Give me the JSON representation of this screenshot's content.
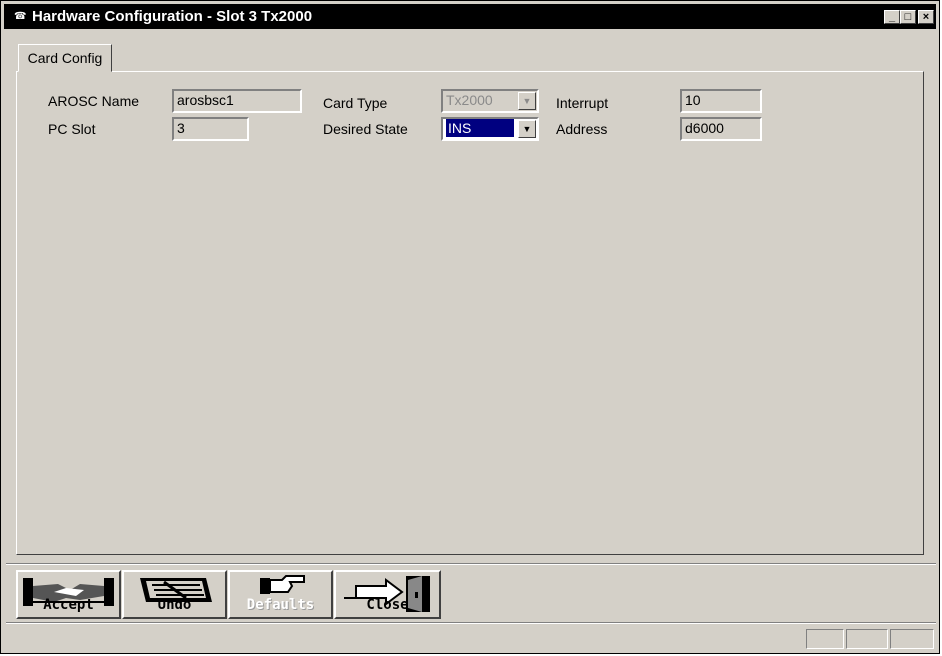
{
  "window": {
    "title": "Hardware Configuration - Slot 3 Tx2000",
    "icon": "telephone-icon",
    "controls": [
      "minimize-icon",
      "maximize-icon",
      "close-icon"
    ]
  },
  "tabs": [
    {
      "label": "Card Config",
      "active": true
    }
  ],
  "form": {
    "arosc_name": {
      "label": "AROSC Name",
      "value": "arosbsc1"
    },
    "pc_slot": {
      "label": "PC Slot",
      "value": "3"
    },
    "card_type": {
      "label": "Card Type",
      "value": "Tx2000",
      "disabled": true
    },
    "desired_state": {
      "label": "Desired State",
      "value": "INS"
    },
    "interrupt": {
      "label": "Interrupt",
      "value": "10"
    },
    "address": {
      "label": "Address",
      "value": "d6000"
    }
  },
  "toolbar": {
    "accept": {
      "label": "Accept",
      "icon": "handshake-icon",
      "enabled": true
    },
    "undo": {
      "label": "Undo",
      "icon": "undo-keyboard-icon",
      "enabled": true
    },
    "defaults": {
      "label": "Defaults",
      "icon": "pointing-hand-icon",
      "enabled": false
    },
    "close": {
      "label": "Close",
      "icon": "exit-door-icon",
      "enabled": true
    }
  },
  "colors": {
    "face": "#d4d0c8",
    "titlebar": "#000000",
    "highlight": "#000080"
  }
}
